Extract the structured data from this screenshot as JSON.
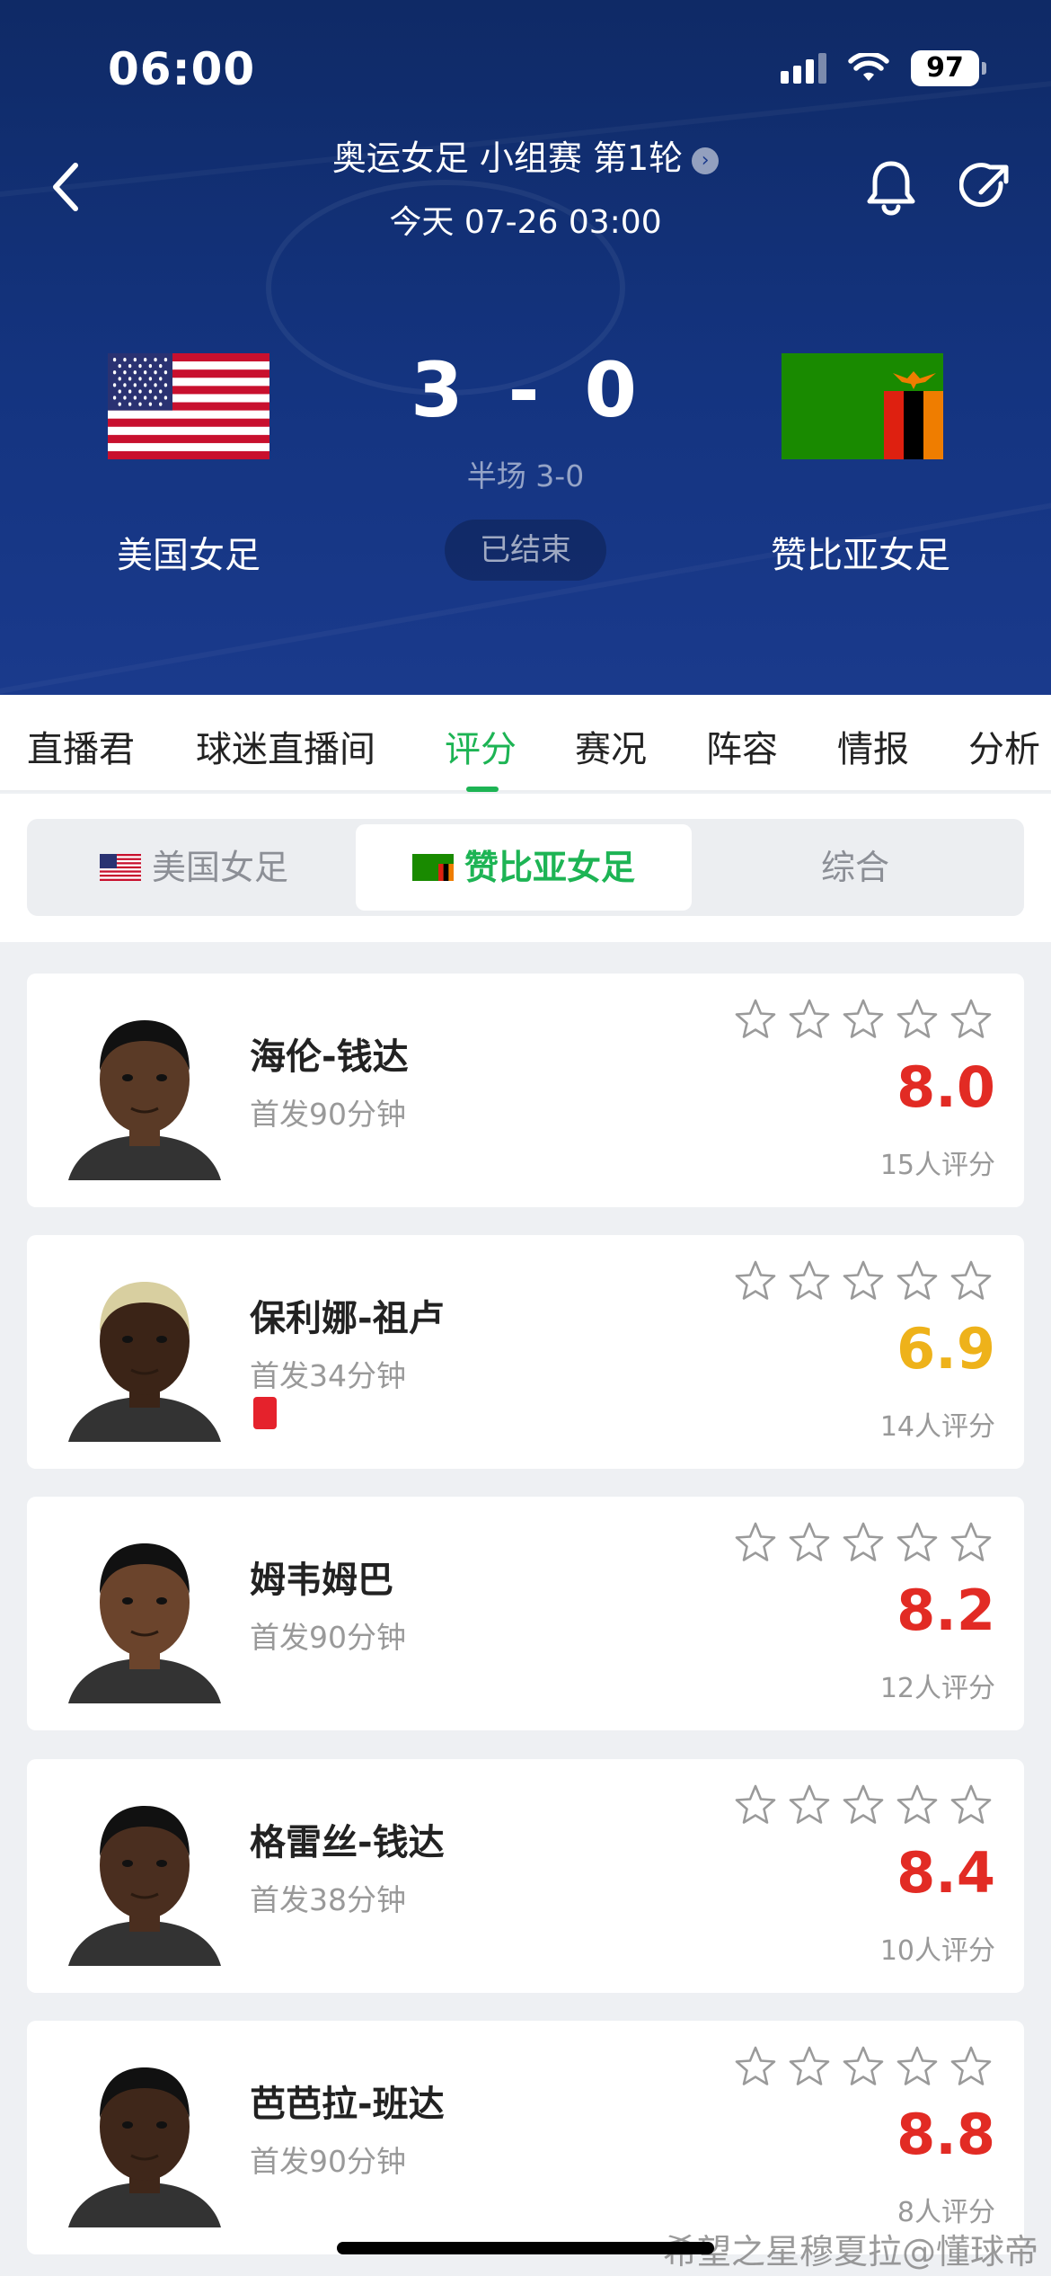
{
  "status_bar": {
    "time": "06:00",
    "battery": "97"
  },
  "match": {
    "competition": "奥运女足 小组赛 第1轮",
    "date": "今天 07-26 03:00",
    "home_team": "美国女足",
    "away_team": "赞比亚女足",
    "home_score": "3",
    "separator": "-",
    "away_score": "0",
    "halftime": "半场 3-0",
    "status": "已结束"
  },
  "tabs": [
    {
      "label": "直播君"
    },
    {
      "label": "球迷直播间"
    },
    {
      "label": "评分",
      "active": true
    },
    {
      "label": "赛况"
    },
    {
      "label": "阵容"
    },
    {
      "label": "情报"
    },
    {
      "label": "分析"
    }
  ],
  "segment": {
    "options": [
      "美国女足",
      "赞比亚女足",
      "综合"
    ],
    "selected": "赞比亚女足"
  },
  "players": [
    {
      "name": "海伦-钱达",
      "minutes": "首发90分钟",
      "rating": "8.0",
      "votes": "15人评分",
      "red_card": false,
      "rating_color": "#e22b24"
    },
    {
      "name": "保利娜-祖卢",
      "minutes": "首发34分钟",
      "rating": "6.9",
      "votes": "14人评分",
      "red_card": true,
      "rating_color": "#eeb21a"
    },
    {
      "name": "姆韦姆巴",
      "minutes": "首发90分钟",
      "rating": "8.2",
      "votes": "12人评分",
      "red_card": false,
      "rating_color": "#e22b24"
    },
    {
      "name": "格雷丝-钱达",
      "minutes": "首发38分钟",
      "rating": "8.4",
      "votes": "10人评分",
      "red_card": false,
      "rating_color": "#e22b24"
    },
    {
      "name": "芭芭拉-班达",
      "minutes": "首发90分钟",
      "rating": "8.8",
      "votes": "8人评分",
      "red_card": false,
      "rating_color": "#e22b24"
    }
  ],
  "watermark": "希望之星穆夏拉@懂球帝",
  "colors": {
    "accent": "#1db454",
    "header_bg": "#143480",
    "rating_high": "#e22b24",
    "rating_mid": "#eeb21a"
  }
}
